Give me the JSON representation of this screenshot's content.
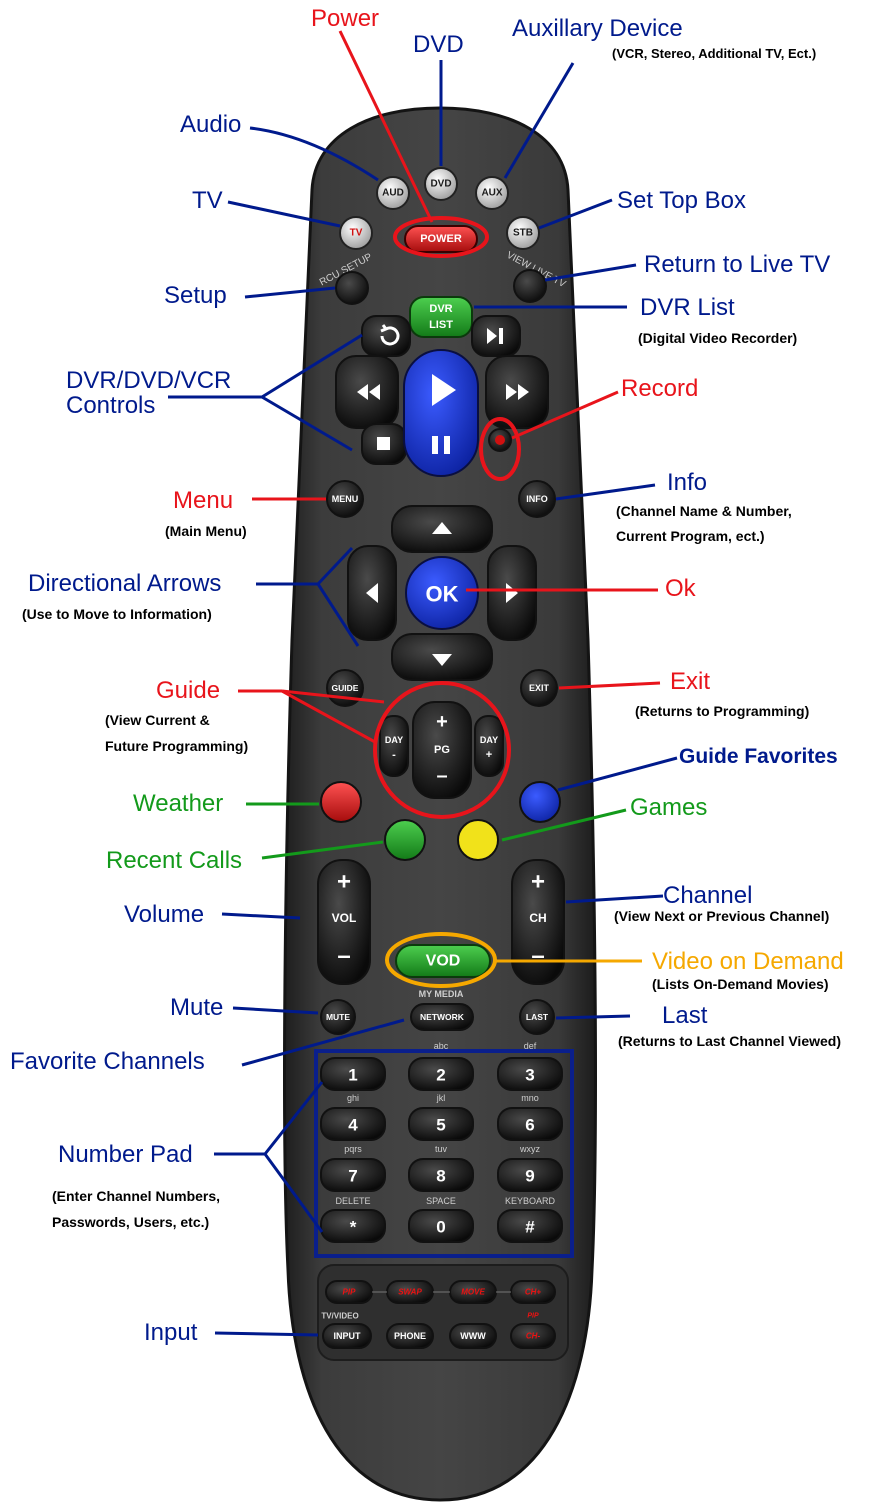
{
  "labels": {
    "power": "Power",
    "dvd": "DVD",
    "aux": "Auxillary Device",
    "aux_sub": "(VCR, Stereo, Additional TV, Ect.)",
    "audio": "Audio",
    "tv": "TV",
    "stb": "Set Top Box",
    "live": "Return to Live TV",
    "setup": "Setup",
    "dvrlist": "DVR List",
    "dvrlist_sub": "(Digital Video Recorder)",
    "controls_1": "DVR/DVD/VCR",
    "controls_2": "Controls",
    "record": "Record",
    "menu": "Menu",
    "menu_sub": "(Main Menu)",
    "info": "Info",
    "info_sub1": "(Channel Name & Number,",
    "info_sub2": "Current Program, ect.)",
    "arrows": "Directional Arrows",
    "arrows_sub": "(Use to Move to Information)",
    "ok": "Ok",
    "guide": "Guide",
    "guide_sub1": "(View Current &",
    "guide_sub2": "Future Programming)",
    "exit": "Exit",
    "exit_sub": "(Returns to Programming)",
    "favorites": "Guide Favorites",
    "weather": "Weather",
    "games": "Games",
    "recent": "Recent Calls",
    "volume": "Volume",
    "channel": "Channel",
    "channel_sub": "(View Next or Previous Channel)",
    "vod": "Video on Demand",
    "vod_sub": "(Lists On-Demand Movies)",
    "mute": "Mute",
    "last": "Last",
    "last_sub": "(Returns to Last Channel Viewed)",
    "favchan": "Favorite Channels",
    "numpad": "Number Pad",
    "numpad_sub1": "(Enter Channel Numbers,",
    "numpad_sub2": "Passwords, Users, etc.)",
    "input": "Input"
  },
  "remote": {
    "aud": "AUD",
    "dvd": "DVD",
    "aux": "AUX",
    "tv": "TV",
    "power": "POWER",
    "stb": "STB",
    "rcu_setup": "RCU SETUP",
    "view_live": "VIEW LIVE TV",
    "dvr_1": "DVR",
    "dvr_2": "LIST",
    "menu": "MENU",
    "info": "INFO",
    "ok": "OK",
    "guide": "GUIDE",
    "exit": "EXIT",
    "day_minus_1": "DAY",
    "day_minus_2": "-",
    "day_plus_1": "DAY",
    "day_plus_2": "+",
    "pg": "PG",
    "vol": "VOL",
    "ch": "CH",
    "vod": "VOD",
    "my_media": "MY MEDIA",
    "mute": "MUTE",
    "network": "NETWORK",
    "last": "LAST",
    "keys": [
      {
        "label": "1",
        "sub": ""
      },
      {
        "label": "2",
        "sub": "abc"
      },
      {
        "label": "3",
        "sub": "def"
      },
      {
        "label": "4",
        "sub": "ghi"
      },
      {
        "label": "5",
        "sub": "jkl"
      },
      {
        "label": "6",
        "sub": "mno"
      },
      {
        "label": "7",
        "sub": "pqrs"
      },
      {
        "label": "8",
        "sub": "tuv"
      },
      {
        "label": "9",
        "sub": "wxyz"
      },
      {
        "label": "*",
        "sub": "DELETE"
      },
      {
        "label": "0",
        "sub": "SPACE"
      },
      {
        "label": "#",
        "sub": "KEYBOARD"
      }
    ],
    "pip": "PIP",
    "swap": "SWAP",
    "move": "MOVE",
    "ch_plus": "CH+",
    "pip2": "PIP",
    "tv_video": "TV/VIDEO",
    "input": "INPUT",
    "phone": "PHONE",
    "www": "WWW",
    "ch_minus": "CH-"
  },
  "colors": {
    "label_blue": "#001a8c",
    "label_red": "#e8141b",
    "label_green": "#139a1b",
    "label_orange": "#f5a800",
    "remote_body": "#3b3b3b"
  }
}
